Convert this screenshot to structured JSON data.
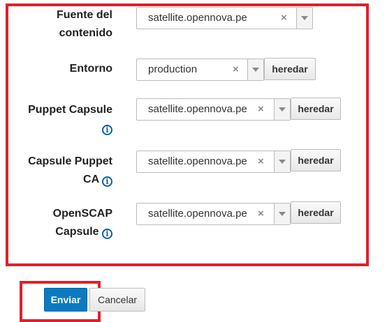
{
  "form": {
    "fields": [
      {
        "label1": "Fuente del",
        "label2": "contenido",
        "value": "satellite.opennova.pe",
        "inherit": ""
      },
      {
        "label1": "Entorno",
        "label2": "",
        "value": "production",
        "inherit": "heredar"
      },
      {
        "label1": "Puppet Capsule",
        "label2": "",
        "value": "satellite.opennova.pe",
        "inherit": "heredar"
      },
      {
        "label1": "Capsule Puppet",
        "label2": "CA",
        "value": "satellite.opennova.pe",
        "inherit": "heredar"
      },
      {
        "label1": "OpenSCAP",
        "label2": "Capsule",
        "value": "satellite.opennova.pe",
        "inherit": "heredar"
      }
    ],
    "info_glyph": "i",
    "clear_glyph": "×"
  },
  "actions": {
    "submit_label": "Enviar",
    "cancel_label": "Cancelar"
  },
  "colors": {
    "highlight": "#e0202a",
    "primary": "#0a7bc1",
    "info": "#0b5ea8"
  }
}
